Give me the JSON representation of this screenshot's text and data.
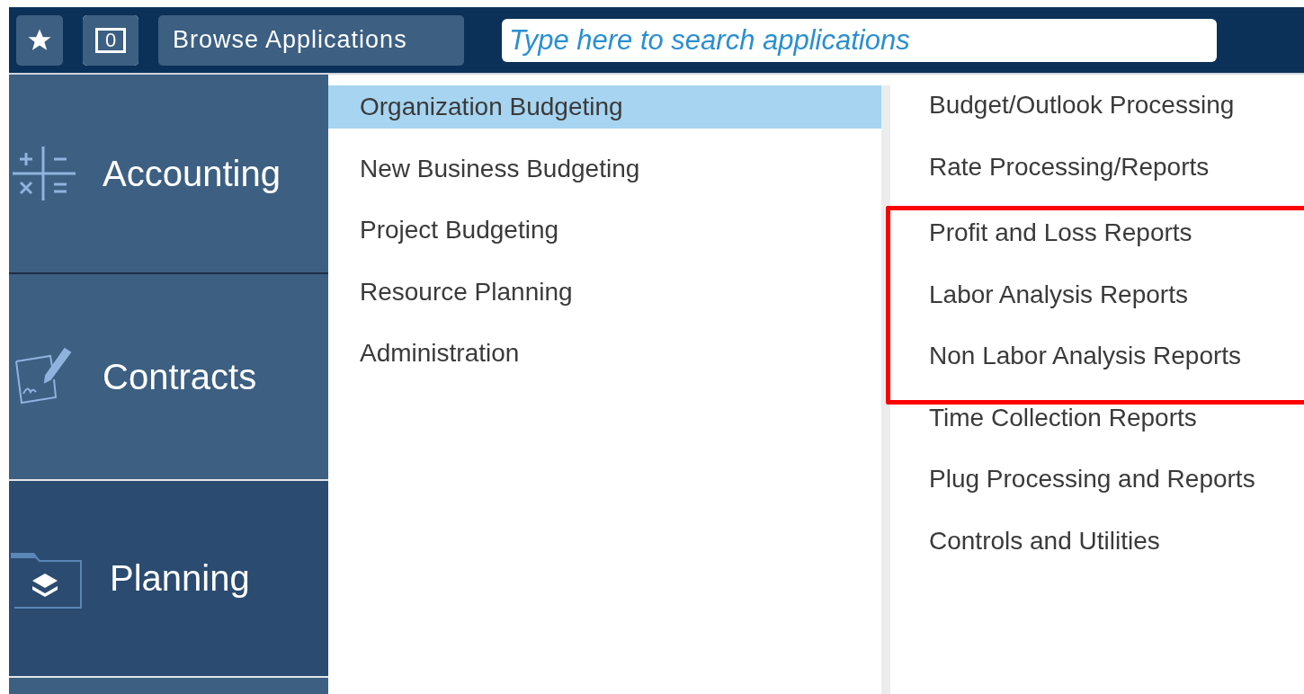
{
  "toolbar": {
    "counter": "0",
    "browse_button": "Browse Applications",
    "search": {
      "placeholder": "Type here to search applications"
    }
  },
  "categories": [
    {
      "label": "Accounting",
      "selected": false
    },
    {
      "label": "Contracts",
      "selected": false
    },
    {
      "label": "Planning",
      "selected": true
    }
  ],
  "submenu": [
    {
      "label": "Organization Budgeting",
      "selected": true
    },
    {
      "label": "New Business Budgeting",
      "selected": false
    },
    {
      "label": "Project Budgeting",
      "selected": false
    },
    {
      "label": "Resource Planning",
      "selected": false
    },
    {
      "label": "Administration",
      "selected": false
    }
  ],
  "applications": [
    {
      "label": "Budget/Outlook Processing",
      "highlighted": false
    },
    {
      "label": "Rate Processing/Reports",
      "highlighted": false
    },
    {
      "label": "Profit and Loss Reports",
      "highlighted": true
    },
    {
      "label": "Labor Analysis Reports",
      "highlighted": true
    },
    {
      "label": "Non Labor Analysis Reports",
      "highlighted": true
    },
    {
      "label": "Time Collection Reports",
      "highlighted": false
    },
    {
      "label": "Plug Processing and Reports",
      "highlighted": false
    },
    {
      "label": "Controls and Utilities",
      "highlighted": false
    }
  ]
}
